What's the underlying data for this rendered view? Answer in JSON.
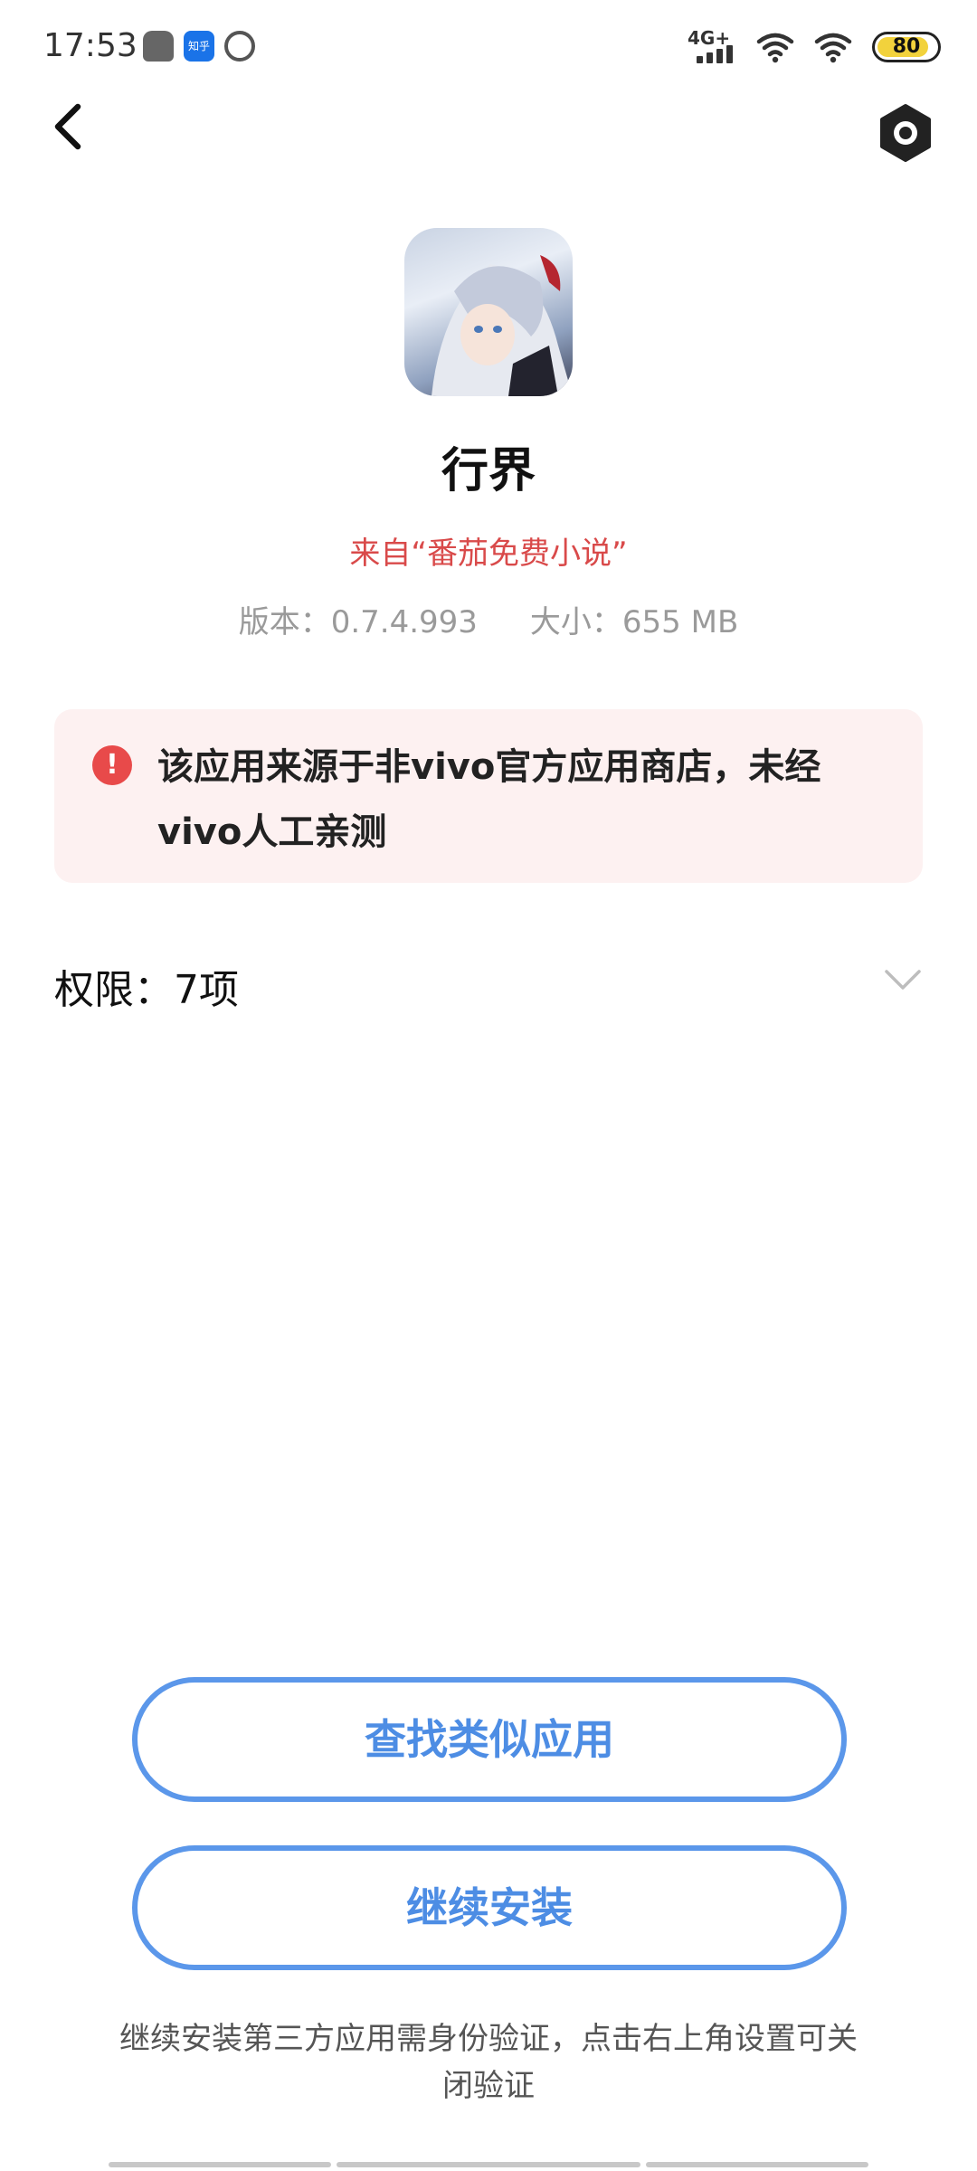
{
  "status_bar": {
    "time": "17:53",
    "app_icons": [
      "robot-icon",
      "zhihu-icon",
      "circle-app-icon"
    ],
    "zhihu_label": "知乎",
    "network": "4G+",
    "battery": "80"
  },
  "nav": {
    "back_icon": "chevron-left-icon",
    "settings_icon": "settings-hexagon-icon"
  },
  "app": {
    "name": "行界",
    "source": "来自“番茄免费小说”",
    "version": "版本：0.7.4.993",
    "size": "大小：655 MB"
  },
  "warning": {
    "icon": "exclamation-icon",
    "text": "该应用来源于非vivo官方应用商店，未经vivo人工亲测"
  },
  "permissions": {
    "label": "权限：7项",
    "chevron": "chevron-down-icon"
  },
  "buttons": {
    "find_similar": "查找类似应用",
    "continue_install": "继续安装"
  },
  "footnote": "继续安装第三方应用需身份验证，点击右上角设置可关闭验证",
  "colors": {
    "accent_blue": "#5b97ea",
    "source_red": "#d94a4a",
    "warning_bg": "#fdf1f1",
    "warning_icon": "#e84a4a"
  }
}
